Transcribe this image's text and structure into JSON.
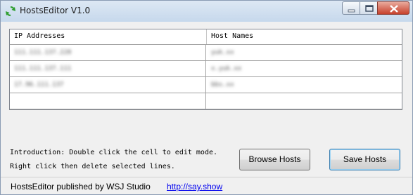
{
  "window": {
    "title": "HostsEditor V1.0"
  },
  "grid": {
    "columns": [
      "IP Addresses",
      "Host Names"
    ],
    "rows": [
      {
        "ip": "111.111.137.228",
        "host": "yuk.xx"
      },
      {
        "ip": "111.111.137.111",
        "host": "x.yuk.xx"
      },
      {
        "ip": "17.96.111.137",
        "host": "bbs.xx"
      },
      {
        "ip": "",
        "host": ""
      }
    ]
  },
  "intro": {
    "line1": "Introduction: Double click the cell to edit mode.",
    "line2": "Right click then delete selected lines."
  },
  "buttons": {
    "browse": "Browse Hosts",
    "save": "Save Hosts"
  },
  "status": {
    "text": "HostsEditor published by WSJ Studio",
    "link": "http://say.show"
  }
}
